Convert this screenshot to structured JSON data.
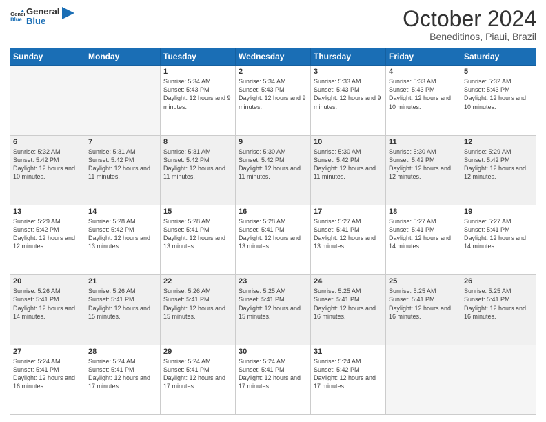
{
  "logo": {
    "line1": "General",
    "line2": "Blue"
  },
  "header": {
    "month": "October 2024",
    "location": "Beneditinos, Piaui, Brazil"
  },
  "weekdays": [
    "Sunday",
    "Monday",
    "Tuesday",
    "Wednesday",
    "Thursday",
    "Friday",
    "Saturday"
  ],
  "weeks": [
    [
      {
        "day": "",
        "sunrise": "",
        "sunset": "",
        "daylight": "",
        "empty": true
      },
      {
        "day": "",
        "sunrise": "",
        "sunset": "",
        "daylight": "",
        "empty": true
      },
      {
        "day": "1",
        "sunrise": "Sunrise: 5:34 AM",
        "sunset": "Sunset: 5:43 PM",
        "daylight": "Daylight: 12 hours and 9 minutes.",
        "empty": false
      },
      {
        "day": "2",
        "sunrise": "Sunrise: 5:34 AM",
        "sunset": "Sunset: 5:43 PM",
        "daylight": "Daylight: 12 hours and 9 minutes.",
        "empty": false
      },
      {
        "day": "3",
        "sunrise": "Sunrise: 5:33 AM",
        "sunset": "Sunset: 5:43 PM",
        "daylight": "Daylight: 12 hours and 9 minutes.",
        "empty": false
      },
      {
        "day": "4",
        "sunrise": "Sunrise: 5:33 AM",
        "sunset": "Sunset: 5:43 PM",
        "daylight": "Daylight: 12 hours and 10 minutes.",
        "empty": false
      },
      {
        "day": "5",
        "sunrise": "Sunrise: 5:32 AM",
        "sunset": "Sunset: 5:43 PM",
        "daylight": "Daylight: 12 hours and 10 minutes.",
        "empty": false
      }
    ],
    [
      {
        "day": "6",
        "sunrise": "Sunrise: 5:32 AM",
        "sunset": "Sunset: 5:42 PM",
        "daylight": "Daylight: 12 hours and 10 minutes.",
        "empty": false
      },
      {
        "day": "7",
        "sunrise": "Sunrise: 5:31 AM",
        "sunset": "Sunset: 5:42 PM",
        "daylight": "Daylight: 12 hours and 11 minutes.",
        "empty": false
      },
      {
        "day": "8",
        "sunrise": "Sunrise: 5:31 AM",
        "sunset": "Sunset: 5:42 PM",
        "daylight": "Daylight: 12 hours and 11 minutes.",
        "empty": false
      },
      {
        "day": "9",
        "sunrise": "Sunrise: 5:30 AM",
        "sunset": "Sunset: 5:42 PM",
        "daylight": "Daylight: 12 hours and 11 minutes.",
        "empty": false
      },
      {
        "day": "10",
        "sunrise": "Sunrise: 5:30 AM",
        "sunset": "Sunset: 5:42 PM",
        "daylight": "Daylight: 12 hours and 11 minutes.",
        "empty": false
      },
      {
        "day": "11",
        "sunrise": "Sunrise: 5:30 AM",
        "sunset": "Sunset: 5:42 PM",
        "daylight": "Daylight: 12 hours and 12 minutes.",
        "empty": false
      },
      {
        "day": "12",
        "sunrise": "Sunrise: 5:29 AM",
        "sunset": "Sunset: 5:42 PM",
        "daylight": "Daylight: 12 hours and 12 minutes.",
        "empty": false
      }
    ],
    [
      {
        "day": "13",
        "sunrise": "Sunrise: 5:29 AM",
        "sunset": "Sunset: 5:42 PM",
        "daylight": "Daylight: 12 hours and 12 minutes.",
        "empty": false
      },
      {
        "day": "14",
        "sunrise": "Sunrise: 5:28 AM",
        "sunset": "Sunset: 5:42 PM",
        "daylight": "Daylight: 12 hours and 13 minutes.",
        "empty": false
      },
      {
        "day": "15",
        "sunrise": "Sunrise: 5:28 AM",
        "sunset": "Sunset: 5:41 PM",
        "daylight": "Daylight: 12 hours and 13 minutes.",
        "empty": false
      },
      {
        "day": "16",
        "sunrise": "Sunrise: 5:28 AM",
        "sunset": "Sunset: 5:41 PM",
        "daylight": "Daylight: 12 hours and 13 minutes.",
        "empty": false
      },
      {
        "day": "17",
        "sunrise": "Sunrise: 5:27 AM",
        "sunset": "Sunset: 5:41 PM",
        "daylight": "Daylight: 12 hours and 13 minutes.",
        "empty": false
      },
      {
        "day": "18",
        "sunrise": "Sunrise: 5:27 AM",
        "sunset": "Sunset: 5:41 PM",
        "daylight": "Daylight: 12 hours and 14 minutes.",
        "empty": false
      },
      {
        "day": "19",
        "sunrise": "Sunrise: 5:27 AM",
        "sunset": "Sunset: 5:41 PM",
        "daylight": "Daylight: 12 hours and 14 minutes.",
        "empty": false
      }
    ],
    [
      {
        "day": "20",
        "sunrise": "Sunrise: 5:26 AM",
        "sunset": "Sunset: 5:41 PM",
        "daylight": "Daylight: 12 hours and 14 minutes.",
        "empty": false
      },
      {
        "day": "21",
        "sunrise": "Sunrise: 5:26 AM",
        "sunset": "Sunset: 5:41 PM",
        "daylight": "Daylight: 12 hours and 15 minutes.",
        "empty": false
      },
      {
        "day": "22",
        "sunrise": "Sunrise: 5:26 AM",
        "sunset": "Sunset: 5:41 PM",
        "daylight": "Daylight: 12 hours and 15 minutes.",
        "empty": false
      },
      {
        "day": "23",
        "sunrise": "Sunrise: 5:25 AM",
        "sunset": "Sunset: 5:41 PM",
        "daylight": "Daylight: 12 hours and 15 minutes.",
        "empty": false
      },
      {
        "day": "24",
        "sunrise": "Sunrise: 5:25 AM",
        "sunset": "Sunset: 5:41 PM",
        "daylight": "Daylight: 12 hours and 16 minutes.",
        "empty": false
      },
      {
        "day": "25",
        "sunrise": "Sunrise: 5:25 AM",
        "sunset": "Sunset: 5:41 PM",
        "daylight": "Daylight: 12 hours and 16 minutes.",
        "empty": false
      },
      {
        "day": "26",
        "sunrise": "Sunrise: 5:25 AM",
        "sunset": "Sunset: 5:41 PM",
        "daylight": "Daylight: 12 hours and 16 minutes.",
        "empty": false
      }
    ],
    [
      {
        "day": "27",
        "sunrise": "Sunrise: 5:24 AM",
        "sunset": "Sunset: 5:41 PM",
        "daylight": "Daylight: 12 hours and 16 minutes.",
        "empty": false
      },
      {
        "day": "28",
        "sunrise": "Sunrise: 5:24 AM",
        "sunset": "Sunset: 5:41 PM",
        "daylight": "Daylight: 12 hours and 17 minutes.",
        "empty": false
      },
      {
        "day": "29",
        "sunrise": "Sunrise: 5:24 AM",
        "sunset": "Sunset: 5:41 PM",
        "daylight": "Daylight: 12 hours and 17 minutes.",
        "empty": false
      },
      {
        "day": "30",
        "sunrise": "Sunrise: 5:24 AM",
        "sunset": "Sunset: 5:41 PM",
        "daylight": "Daylight: 12 hours and 17 minutes.",
        "empty": false
      },
      {
        "day": "31",
        "sunrise": "Sunrise: 5:24 AM",
        "sunset": "Sunset: 5:42 PM",
        "daylight": "Daylight: 12 hours and 17 minutes.",
        "empty": false
      },
      {
        "day": "",
        "sunrise": "",
        "sunset": "",
        "daylight": "",
        "empty": true
      },
      {
        "day": "",
        "sunrise": "",
        "sunset": "",
        "daylight": "",
        "empty": true
      }
    ]
  ]
}
